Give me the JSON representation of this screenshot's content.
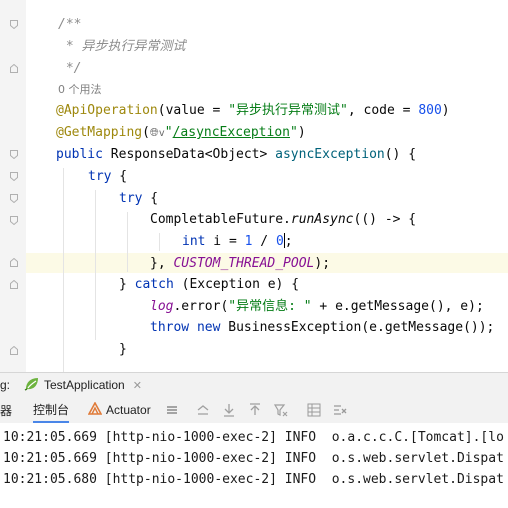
{
  "editor": {
    "comment_open": "/**",
    "comment_text": " * 异步执行异常测试",
    "comment_close": " */",
    "usage_hint": "0 个用法",
    "api_op": {
      "anno": "@ApiOperation",
      "p1": "(value = ",
      "value": "\"异步执行异常测试\"",
      "p2": ", code = ",
      "code": "800",
      "p3": ")"
    },
    "get_mapping": {
      "anno": "@GetMapping",
      "p1": "(",
      "glyph": "🌐︎",
      "chev": "v",
      "q1": "\"",
      "path": "/asyncException",
      "q2": "\"",
      "p2": ")"
    },
    "method_sig": {
      "kw": "public",
      "type": " ResponseData<Object> ",
      "name": "asyncException",
      "rest": "() {"
    },
    "try1": {
      "kw": "try",
      "rest": " {"
    },
    "try2": {
      "kw": "try",
      "rest": " {"
    },
    "cf_line": {
      "cls": "CompletableFuture.",
      "mth": "runAsync",
      "rest": "(() -> {"
    },
    "int_line": {
      "kw": "int",
      "mid": " i = ",
      "n1": "1",
      "op": " / ",
      "n2": "0",
      "end": ";"
    },
    "pool_line": {
      "pre": "}, ",
      "field": "CUSTOM_THREAD_POOL",
      "post": ");"
    },
    "catch_line": {
      "pre": "} ",
      "kw": "catch",
      "rest": " (Exception e) {"
    },
    "log_line": {
      "field": "log",
      "p1": ".error(",
      "str": "\"异常信息: \"",
      "p2": " + e.getMessage(), e);"
    },
    "throw_line": {
      "kw1": "throw",
      "kw2": "new",
      "rest": " BusinessException(e.getMessage());"
    },
    "close_brace": "}"
  },
  "run_bar": {
    "label": "g:",
    "tab_label": "TestApplication",
    "close": "✕"
  },
  "toolbar": {
    "left_label": "器",
    "console_label": "控制台",
    "actuator_label": "Actuator"
  },
  "console": {
    "lines": [
      "10:21:05.669 [http-nio-1000-exec-2] INFO  o.a.c.c.C.[Tomcat].[lo",
      "10:21:05.669 [http-nio-1000-exec-2] INFO  o.s.web.servlet.Dispat",
      "10:21:05.680 [http-nio-1000-exec-2] INFO  o.s.web.servlet.Dispat"
    ]
  },
  "colors": {
    "keyword": "#0033b3",
    "string": "#067d17",
    "annotation": "#9e880d",
    "number": "#1750eb",
    "static_field": "#871094",
    "comment": "#8c8c8c"
  },
  "icons": [
    "fold-marker-icon",
    "spring-boot-icon",
    "actuator-icon",
    "menu-lines-icon",
    "scroll-up-icon",
    "download-icon",
    "upload-icon",
    "filter-icon",
    "grid-icon",
    "clear-all-icon",
    "globe-icon"
  ]
}
